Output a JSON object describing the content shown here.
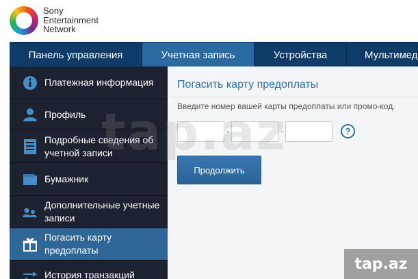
{
  "logo": {
    "lines": [
      "Sony",
      "Entertainment",
      "Network"
    ]
  },
  "topnav": {
    "tabs": [
      {
        "label": "Панель управления",
        "active": false
      },
      {
        "label": "Учетная запись",
        "active": true
      },
      {
        "label": "Устройства",
        "active": false
      },
      {
        "label": "Мультимед",
        "active": false
      }
    ]
  },
  "sidebar": {
    "items": [
      {
        "label": "Платежная информация",
        "icon": "info-icon",
        "active": false
      },
      {
        "label": "Профиль",
        "icon": "person-icon",
        "active": false
      },
      {
        "label": "Подробные сведения об учетной записи",
        "icon": "document-icon",
        "active": false
      },
      {
        "label": "Бумажник",
        "icon": "wallet-icon",
        "active": false
      },
      {
        "label": "Дополнительные учетные записи",
        "icon": "users-icon",
        "active": false
      },
      {
        "label": "Погасить карту предоплаты",
        "icon": "gift-icon",
        "active": true
      },
      {
        "label": "История транзакций",
        "icon": "transfer-arrows-icon",
        "active": false
      }
    ]
  },
  "main": {
    "title": "Погасить карту предоплаты",
    "description": "Введите номер вашей карты предоплаты или промо-код.",
    "code_fields": [
      "",
      "",
      ""
    ],
    "separator": "-",
    "help": "?",
    "continue_label": "Продолжить"
  },
  "watermark": {
    "big": "tap.az",
    "corner": "tap.az"
  },
  "colors": {
    "nav_bg": "#0f3b68",
    "nav_active": "#2a6aa0",
    "sidebar_bg": "#1d2230",
    "sidebar_active": "#2e6797",
    "accent": "#2d6ea5"
  }
}
